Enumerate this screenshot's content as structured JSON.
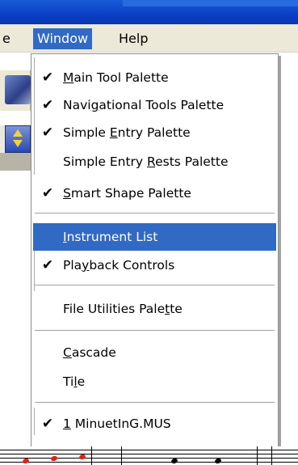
{
  "menubar": {
    "items": [
      {
        "label": "e"
      },
      {
        "label": "Window"
      },
      {
        "label": "Help"
      }
    ]
  },
  "window_menu": {
    "items": [
      {
        "pre": "",
        "u": "M",
        "post": "ain Tool Palette",
        "checked": true
      },
      {
        "pre": "Navi",
        "u": "g",
        "post": "ational Tools Palette",
        "checked": true
      },
      {
        "pre": "Simple ",
        "u": "E",
        "post": "ntry Palette",
        "checked": true
      },
      {
        "pre": "Simple Entry ",
        "u": "R",
        "post": "ests Palette",
        "checked": false
      },
      {
        "pre": "",
        "u": "S",
        "post": "mart Shape Palette",
        "checked": true
      },
      {
        "pre": "",
        "u": "I",
        "post": "nstrument List",
        "checked": false,
        "highlighted": true
      },
      {
        "pre": "Pla",
        "u": "y",
        "post": "back Controls",
        "checked": true
      },
      {
        "pre": "File Utilities Pale",
        "u": "t",
        "post": "te",
        "checked": false
      },
      {
        "pre": "",
        "u": "C",
        "post": "ascade",
        "checked": false
      },
      {
        "pre": "Ti",
        "u": "l",
        "post": "e",
        "checked": false
      },
      {
        "pre": "",
        "u": "1",
        "post": " MinuetInG.MUS",
        "checked": true
      }
    ]
  },
  "check_glyph": "✔",
  "colors": {
    "highlight": "#316ac5",
    "menubar": "#ece9d8",
    "titlebar": "#0a3fc4",
    "note": "#e0201a"
  }
}
